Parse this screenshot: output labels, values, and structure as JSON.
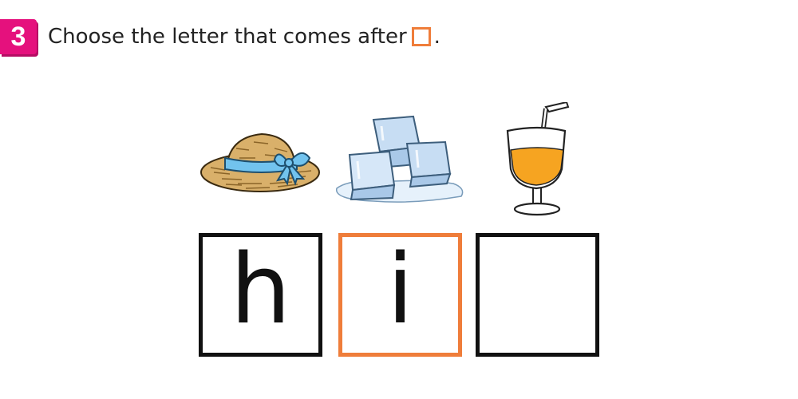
{
  "question": {
    "number": "3",
    "text": "Choose the letter that comes after",
    "period": "."
  },
  "pictures": [
    {
      "icon": "straw-hat-icon"
    },
    {
      "icon": "ice-cubes-icon"
    },
    {
      "icon": "juice-glass-icon"
    }
  ],
  "boxes": [
    {
      "letter": "h",
      "border": "#111111"
    },
    {
      "letter": "i",
      "border": "#ef7d3a"
    },
    {
      "letter": "",
      "border": "#111111"
    }
  ],
  "colors": {
    "number_badge": "#e5117d",
    "highlight": "#ef7d3a"
  }
}
